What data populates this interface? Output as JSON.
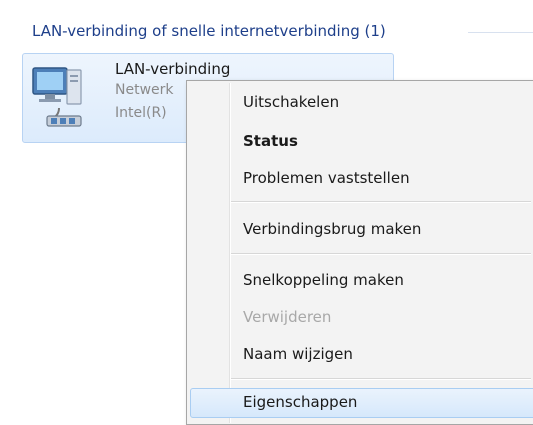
{
  "group": {
    "header": "LAN-verbinding of snelle internetverbinding (1)"
  },
  "connection": {
    "name": "LAN-verbinding",
    "subtitle1": "Netwerk",
    "subtitle2": "Intel(R)",
    "icon": "network-adapter-icon"
  },
  "context_menu": {
    "items": [
      {
        "label": "Uitschakelen"
      },
      {
        "label": "Status"
      },
      {
        "label": "Problemen vaststellen"
      },
      {
        "label": "Verbindingsbrug maken"
      },
      {
        "label": "Snelkoppeling maken"
      },
      {
        "label": "Verwijderen"
      },
      {
        "label": "Naam wijzigen"
      },
      {
        "label": "Eigenschappen"
      }
    ]
  }
}
